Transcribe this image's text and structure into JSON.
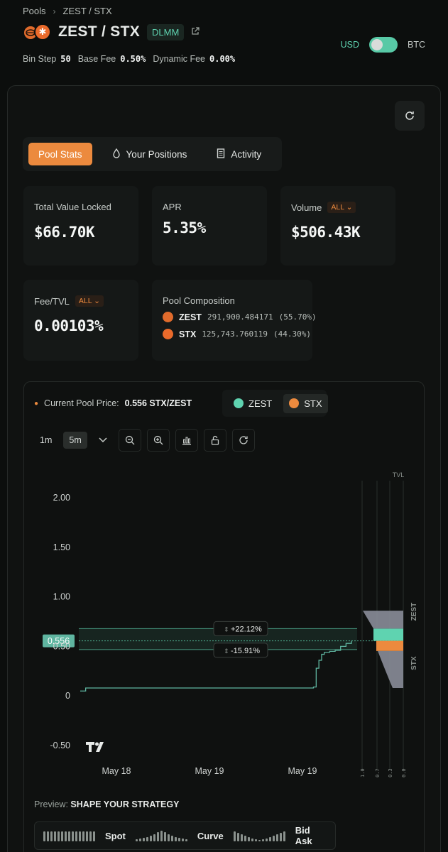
{
  "breadcrumb": {
    "root": "Pools",
    "current": "ZEST / STX"
  },
  "header": {
    "title": "ZEST / STX",
    "badge": "DLMM",
    "fees": {
      "bin_step_label": "Bin Step",
      "bin_step": "50",
      "base_fee_label": "Base Fee",
      "base_fee": "0.50%",
      "dynamic_fee_label": "Dynamic Fee",
      "dynamic_fee": "0.00%"
    },
    "currency": {
      "left": "USD",
      "right": "BTC"
    }
  },
  "tabs": [
    {
      "label": "Pool Stats"
    },
    {
      "label": "Your Positions"
    },
    {
      "label": "Activity"
    }
  ],
  "stats": {
    "tvl": {
      "label": "Total Value Locked",
      "value": "$66.70K"
    },
    "apr": {
      "label": "APR",
      "value": "5.35%"
    },
    "volume": {
      "label": "Volume",
      "filter": "ALL",
      "value": "$506.43K"
    },
    "fee_tvl": {
      "label": "Fee/TVL",
      "filter": "ALL",
      "value": "0.00103%"
    },
    "composition": {
      "label": "Pool Composition",
      "items": [
        {
          "symbol": "ZEST",
          "amount": "291,900.484171",
          "pct": "(55.70%)"
        },
        {
          "symbol": "STX",
          "amount": "125,743.760119",
          "pct": "(44.30%)"
        }
      ]
    }
  },
  "price_panel": {
    "label": "Current Pool Price:",
    "value": "0.556 STX/ZEST",
    "legend": [
      {
        "name": "ZEST",
        "color": "#5fd3b0"
      },
      {
        "name": "STX",
        "color": "#ec8a3e"
      }
    ],
    "timeframes": [
      "1m",
      "5m"
    ],
    "tool_icons": [
      "chevron-down-icon",
      "zoom-out-icon",
      "zoom-in-icon",
      "chart-icon",
      "unlock-icon",
      "reset-icon"
    ]
  },
  "chart_data": {
    "type": "line",
    "y_ticks": [
      "2.00",
      "1.50",
      "1.00",
      "0.50",
      "0",
      "-0.50"
    ],
    "x_ticks": [
      "May 18",
      "May 19",
      "May 19"
    ],
    "current_price_label": "0.556",
    "range_upper_label": "+22.12%",
    "range_lower_label": "-15.91%",
    "ylim": [
      -0.5,
      2.0
    ],
    "current_price": 0.556,
    "range_upper": 0.679,
    "range_lower": 0.468,
    "series": [
      {
        "values": [
          [
            0,
            0.05
          ],
          [
            0.02,
            0.08
          ],
          [
            0.85,
            0.08
          ],
          [
            0.86,
            0.09
          ],
          [
            0.87,
            0.28
          ],
          [
            0.88,
            0.36
          ],
          [
            0.89,
            0.42
          ],
          [
            0.9,
            0.44
          ],
          [
            0.92,
            0.45
          ],
          [
            0.94,
            0.46
          ],
          [
            0.96,
            0.5
          ],
          [
            0.98,
            0.53
          ],
          [
            1.0,
            0.556
          ]
        ]
      }
    ],
    "tvl_axis_label": "TVL",
    "tvl_ticks": [
      "1.0",
      "0.7",
      "0.3",
      "0.0"
    ],
    "side_labels": [
      "ZEST",
      "STX"
    ]
  },
  "strategy": {
    "prefix": "Preview:",
    "title": "SHAPE YOUR STRATEGY",
    "options": [
      {
        "label": "Spot"
      },
      {
        "label": "Curve"
      },
      {
        "label": "Bid Ask"
      }
    ]
  }
}
